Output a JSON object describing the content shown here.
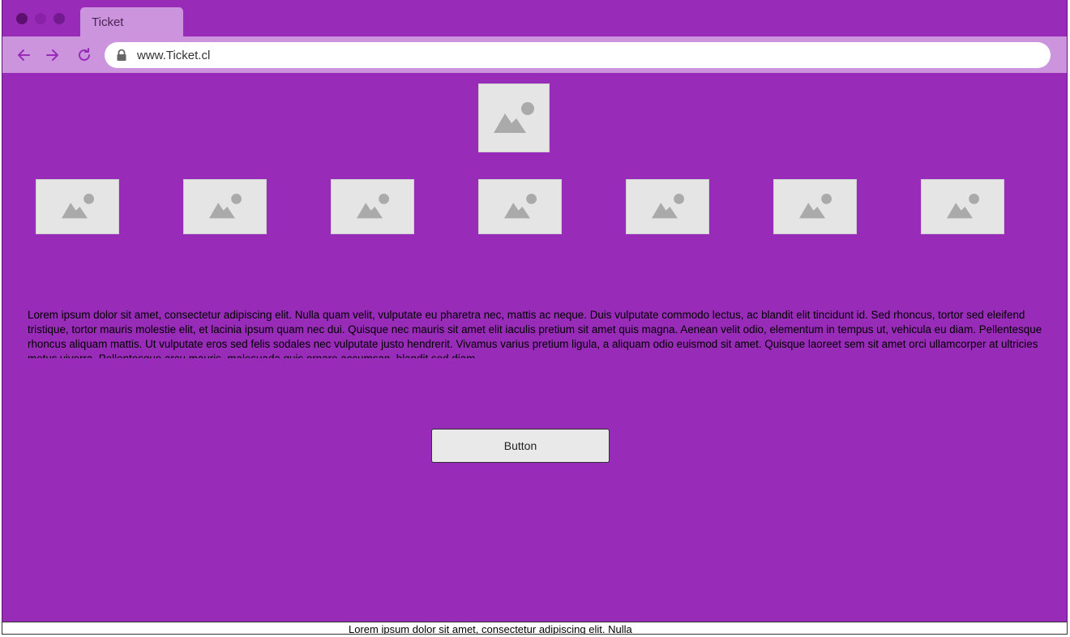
{
  "browser": {
    "tab_title": "Ticket",
    "url": "www.Ticket.cl",
    "colors": {
      "window": "#982cb8",
      "toolbar": "#cc94dc",
      "nav_icons": "#982cb8"
    },
    "nav_icons": [
      "arrow-left-icon",
      "arrow-right-icon",
      "reload-icon",
      "lock-icon"
    ]
  },
  "content": {
    "hero_image": "image-placeholder-icon",
    "thumbnails_count": 7,
    "paragraph": "Lorem ipsum dolor sit amet, consectetur adipiscing elit. Nulla quam velit, vulputate eu pharetra nec, mattis ac neque. Duis vulputate commodo lectus, ac blandit elit tincidunt id. Sed rhoncus, tortor sed eleifend tristique, tortor mauris molestie elit, et lacinia ipsum quam nec dui. Quisque nec mauris sit amet elit iaculis pretium sit amet quis magna. Aenean velit odio, elementum in tempus ut, vehicula eu diam. Pellentesque rhoncus aliquam mattis. Ut vulputate eros sed felis sodales nec vulputate justo hendrerit. Vivamus varius pretium ligula, a aliquam odio euismod sit amet. Quisque laoreet sem sit amet orci ullamcorper at ultricies metus viverra. Pellentesque arcu mauris, malesuada quis ornare accumsan, blandit sed diam.",
    "button_label": "Button"
  },
  "footer": {
    "text": "Lorem ipsum dolor sit amet, consectetur adipiscing elit. Nulla"
  }
}
